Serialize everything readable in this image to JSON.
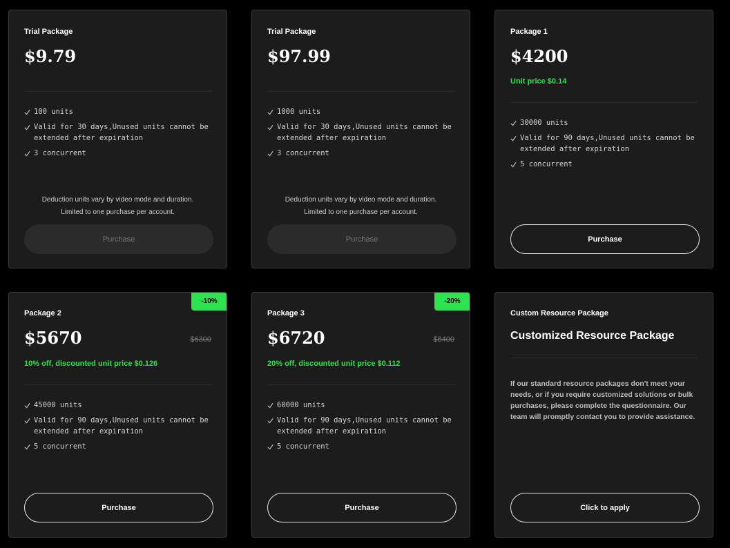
{
  "colors": {
    "background": "#000000",
    "card": "#1c1c1c",
    "accent_green": "#2ee24f"
  },
  "icons": {
    "feature_bullet": "check-icon"
  },
  "cards": [
    {
      "name": "Trial Package",
      "price": "$9.79",
      "features": [
        "100 units",
        "Valid for 30 days,Unused units cannot be extended after expiration",
        "3 concurrent"
      ],
      "notice_lines": [
        "Deduction units vary by video mode and duration.",
        "Limited to one purchase per account."
      ],
      "button": "Purchase",
      "button_state": "disabled"
    },
    {
      "name": "Trial Package",
      "price": "$97.99",
      "features": [
        "1000 units",
        "Valid for 30 days,Unused units cannot be extended after expiration",
        "3 concurrent"
      ],
      "notice_lines": [
        "Deduction units vary by video mode and duration.",
        "Limited to one purchase per account."
      ],
      "button": "Purchase",
      "button_state": "disabled"
    },
    {
      "name": "Package 1",
      "price": "$4200",
      "note": "Unit price $0.14",
      "features": [
        "30000 units",
        "Valid for 90 days,Unused units cannot be extended after expiration",
        "5 concurrent"
      ],
      "button": "Purchase",
      "button_state": "enabled"
    },
    {
      "name": "Package 2",
      "badge": "-10%",
      "price": "$5670",
      "original_price": "$6300",
      "note": "10% off, discounted unit price $0.126",
      "features": [
        "45000 units",
        "Valid for 90 days,Unused units cannot be extended after expiration",
        "5 concurrent"
      ],
      "button": "Purchase",
      "button_state": "enabled"
    },
    {
      "name": "Package 3",
      "badge": "-20%",
      "price": "$6720",
      "original_price": "$8400",
      "note": "20% off, discounted unit price $0.112",
      "features": [
        "60000 units",
        "Valid for 90 days,Unused units cannot be extended after expiration",
        "5 concurrent"
      ],
      "button": "Purchase",
      "button_state": "enabled"
    },
    {
      "name": "Custom Resource Package",
      "title": "Customized Resource Package",
      "description": "If our standard resource packages don't meet your needs, or if you require customized solutions or bulk purchases, please complete the questionnaire. Our team will promptly contact you to provide assistance.",
      "button": "Click to apply",
      "button_state": "enabled"
    }
  ]
}
